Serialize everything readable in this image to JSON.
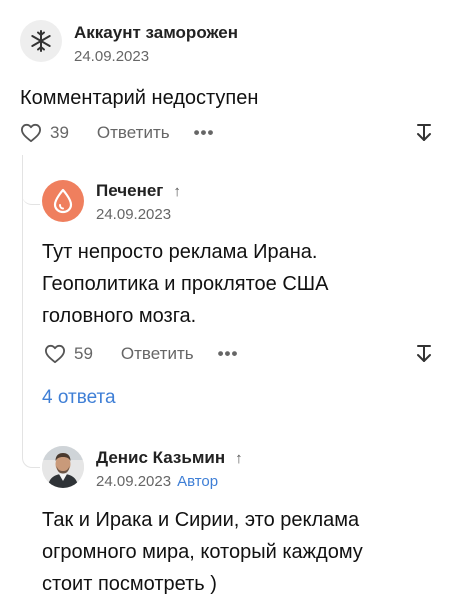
{
  "comments": [
    {
      "author": "Аккаунт заморожен",
      "date": "24.09.2023",
      "text": "Комментарий недоступен",
      "likes": "39",
      "reply_label": "Ответить",
      "more_label": "•••",
      "avatar_icon": "snowflake-icon"
    },
    {
      "author": "Печенег",
      "author_arrow": "↑",
      "date": "24.09.2023",
      "text_lines": [
        "Тут непросто реклама Ирана.",
        "Геополитика и проклятое США",
        "головного мозга."
      ],
      "likes": "59",
      "reply_label": "Ответить",
      "more_label": "•••",
      "avatar_icon": "drop-icon",
      "avatar_color": "#ef7f5e"
    },
    {
      "author": "Денис Казьмин",
      "author_arrow": "↑",
      "date": "24.09.2023",
      "badge": "Автор",
      "text_lines": [
        "Так и Ирака и Сирии, это реклама",
        "огромного мира, который каждому",
        "стоит посмотреть )"
      ],
      "avatar_icon": "user-photo-icon"
    }
  ],
  "replies_link": "4 ответа",
  "colors": {
    "accent": "#3f7fd6",
    "muted": "#666666",
    "thread_line": "#e3e3e3"
  }
}
